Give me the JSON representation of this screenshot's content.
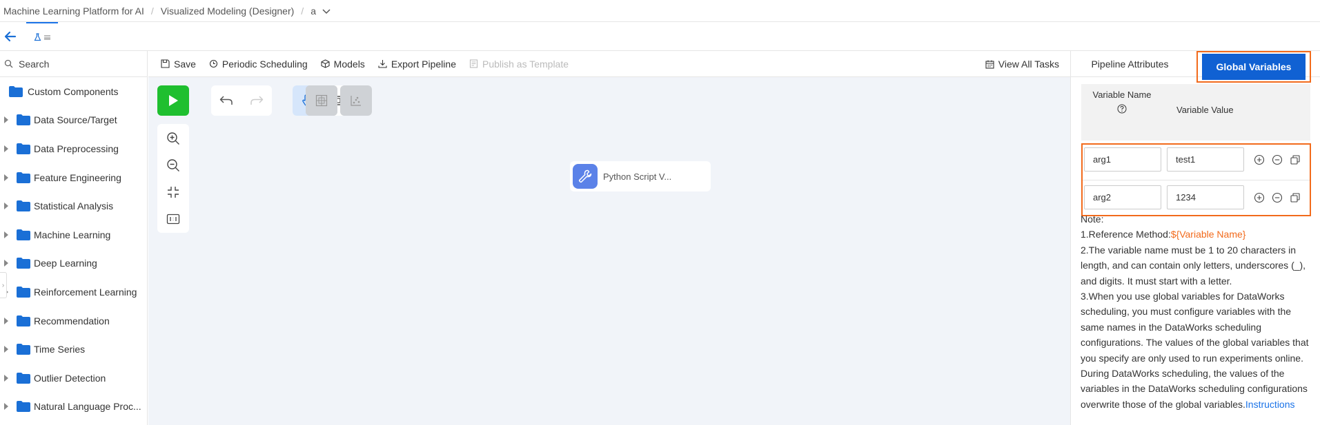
{
  "breadcrumb": {
    "items": [
      "Machine Learning Platform for AI",
      "Visualized Modeling (Designer)",
      "a"
    ]
  },
  "sidebar": {
    "search_placeholder": "Search",
    "items": [
      {
        "label": "Custom Components"
      },
      {
        "label": "Data Source/Target"
      },
      {
        "label": "Data Preprocessing"
      },
      {
        "label": "Feature Engineering"
      },
      {
        "label": "Statistical Analysis"
      },
      {
        "label": "Machine Learning"
      },
      {
        "label": "Deep Learning"
      },
      {
        "label": "Reinforcement Learning"
      },
      {
        "label": "Recommendation"
      },
      {
        "label": "Time Series"
      },
      {
        "label": "Outlier Detection"
      },
      {
        "label": "Natural Language Proc..."
      }
    ]
  },
  "toolbar": {
    "save": "Save",
    "periodic": "Periodic Scheduling",
    "models": "Models",
    "export": "Export Pipeline",
    "publish": "Publish as Template",
    "view_all": "View All Tasks"
  },
  "canvas": {
    "node_label": "Python Script V..."
  },
  "panel": {
    "tab_attributes": "Pipeline Attributes",
    "tab_global": "Global Variables",
    "col_name": "Variable Name",
    "col_value": "Variable Value",
    "variables": [
      {
        "name": "arg1",
        "value": "test1"
      },
      {
        "name": "arg2",
        "value": "1234"
      }
    ],
    "note": {
      "title": "Note:",
      "line1_prefix": "1.Reference Method:",
      "line1_code": "${Variable Name}",
      "line2": "2.The variable name must be 1 to 20 characters in length, and can contain only letters, underscores (_), and digits. It must start with a letter.",
      "line3": "3.When you use global variables for DataWorks scheduling, you must configure variables with the same names in the DataWorks scheduling configurations. The values of the global variables that you specify are only used to run experiments online. During DataWorks scheduling, the values of the variables in the DataWorks scheduling configurations overwrite those of the global variables.",
      "link": "Instructions"
    }
  },
  "colors": {
    "accent": "#1061d3",
    "highlight": "#f26a1b",
    "run": "#1fbf2f",
    "folder": "#1a6fd6"
  }
}
